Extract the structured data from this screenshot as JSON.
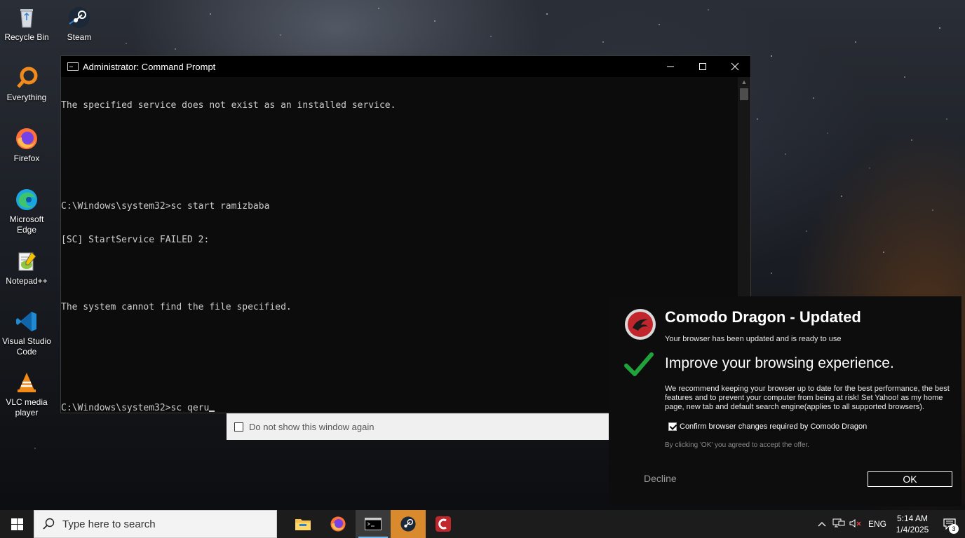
{
  "desktop": {
    "icons": [
      {
        "label": "Recycle Bin",
        "icon": "recycle-bin-icon"
      },
      {
        "label": "Steam",
        "icon": "steam-icon"
      },
      {
        "label": "Everything",
        "icon": "everything-icon"
      },
      {
        "label": "Firefox",
        "icon": "firefox-icon"
      },
      {
        "label": "Microsoft Edge",
        "icon": "edge-icon"
      },
      {
        "label": "Notepad++",
        "icon": "notepad-plus-plus-icon"
      },
      {
        "label": "Visual Studio Code",
        "icon": "vscode-icon"
      },
      {
        "label": "VLC media player",
        "icon": "vlc-icon"
      }
    ]
  },
  "cmd": {
    "title": "Administrator: Command Prompt",
    "lines": [
      "The specified service does not exist as an installed service.",
      "",
      "",
      "C:\\Windows\\system32>sc start ramizbaba",
      "[SC] StartService FAILED 2:",
      "",
      "The system cannot find the file specified.",
      "",
      "",
      "C:\\Windows\\system32>sc qeru"
    ],
    "colors": {
      "background": "#0c0c0c",
      "text": "#cccccc"
    }
  },
  "dont_show": {
    "label": "Do not show this window again",
    "checked": false
  },
  "popup": {
    "title": "Comodo Dragon - Updated",
    "subtitle": "Your browser has been updated and is ready to use",
    "headline": "Improve your browsing experience.",
    "body": "We recommend keeping your browser up to date for the best performance, the best features and to prevent your computer from being at risk! Set Yahoo! as my home page, new tab and default search engine(applies to all supported browsers).",
    "confirm_label": "Confirm browser changes required by Comodo Dragon",
    "confirm_checked": true,
    "legal": "By clicking 'OK' you agreed to accept the offer.",
    "decline_label": "Decline",
    "ok_label": "OK",
    "colors": {
      "check": "#1fa33a",
      "logo": "#c0262c"
    }
  },
  "taskbar": {
    "search_placeholder": "Type here to search",
    "apps": [
      {
        "name": "file-explorer-icon",
        "active": false
      },
      {
        "name": "firefox-icon",
        "active": false
      },
      {
        "name": "command-prompt-icon",
        "active": true
      },
      {
        "name": "steam-icon",
        "active": false
      },
      {
        "name": "comodo-dragon-icon",
        "active": false
      }
    ],
    "tray": {
      "language": "ENG",
      "time": "5:14 AM",
      "date": "1/4/2025",
      "notification_count": "3"
    }
  }
}
